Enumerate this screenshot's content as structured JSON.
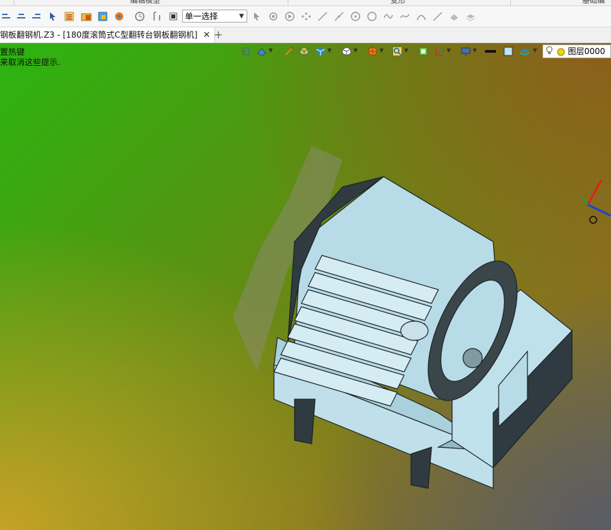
{
  "ribbon": {
    "groups": [
      "编辑模型",
      "变形",
      "基础编辑"
    ]
  },
  "toolbar": {
    "selection_mode": "单一选择"
  },
  "tabs": [
    {
      "label": "钢板翻钢机.Z3 - [180度滚筒式C型翻转台钢板翻钢机]"
    }
  ],
  "viewport": {
    "hint_line1": "置热键",
    "hint_line2": "来取消这些提示.",
    "layer": "图层0000"
  },
  "colors": {
    "bg_top_left": "#2bb511",
    "bg_bottom_right": "#5a5c66",
    "model_blue": "#b7dce8",
    "model_dark": "#2f3b40"
  }
}
